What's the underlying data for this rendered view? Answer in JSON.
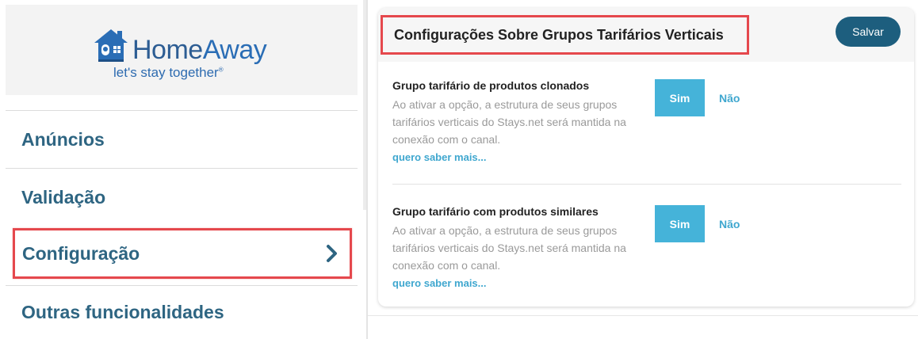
{
  "brand": {
    "name_part1": "Home",
    "name_part2": "Away",
    "tagline": "let's stay together",
    "tagline_mark": "®"
  },
  "sidebar": {
    "items": [
      {
        "label": "Anúncios"
      },
      {
        "label": "Validação"
      },
      {
        "label": "Configuração",
        "active": true
      },
      {
        "label": "Outras funcionalidades"
      }
    ]
  },
  "panel": {
    "title": "Configurações Sobre Grupos Tarifários Verticais",
    "save_label": "Salvar",
    "settings": [
      {
        "title": "Grupo tarifário de produtos clonados",
        "description": "Ao ativar a opção, a estrutura de seus grupos tarifários verticais do Stays.net será mantida na conexão com o canal.",
        "link": "quero saber mais...",
        "yes_label": "Sim",
        "no_label": "Não"
      },
      {
        "title": "Grupo tarifário com produtos similares",
        "description": "Ao ativar a opção, a estrutura de seus grupos tarifários verticais do Stays.net será mantida na conexão com o canal.",
        "link": "quero saber mais...",
        "yes_label": "Sim",
        "no_label": "Não"
      }
    ]
  },
  "colors": {
    "accent": "#2e6582",
    "save_button": "#1d5e7e",
    "yes_button": "#45b3d9",
    "link": "#3fa7cf",
    "highlight": "#e5484d"
  },
  "icons": {
    "logo": "house-logo-icon",
    "nav_arrow": "chevron-right-icon"
  }
}
